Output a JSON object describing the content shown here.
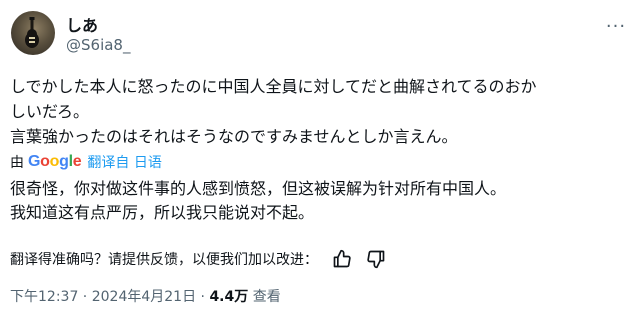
{
  "author": {
    "name": "しあ",
    "handle": "@S6ia8_",
    "avatar_icon": "guitar-avatar-icon"
  },
  "menu": {
    "more_label": "···"
  },
  "tweet": {
    "lines": [
      "しでかした本人に怒ったのに中国人全員に対してだと曲解されてるのおか",
      "しいだろ。",
      "言葉強かったのはそれはそうなのですみませんとしか言えん。"
    ]
  },
  "translation": {
    "by_label": "由",
    "provider": "Google",
    "link_label": "翻译自 日语",
    "lines": [
      "很奇怪，你对做这件事的人感到愤怒，但这被误解为针对所有中国人。",
      "我知道这有点严厉，所以我只能说对不起。"
    ],
    "feedback_prompt": "翻译得准确吗？请提供反馈，以便我们加以改进：",
    "thumb_up_icon": "thumbs-up-icon",
    "thumb_down_icon": "thumbs-down-icon"
  },
  "meta": {
    "time": "下午12:37",
    "separator": " · ",
    "date": "2024年4月21日",
    "views_count": "4.4万",
    "views_label": "查看"
  },
  "colors": {
    "text": "#0f1419",
    "secondary": "#536471",
    "link": "#1d9bf0",
    "google_blue": "#4285F4",
    "google_red": "#EA4335",
    "google_yellow": "#FBBC05",
    "google_green": "#34A853"
  }
}
